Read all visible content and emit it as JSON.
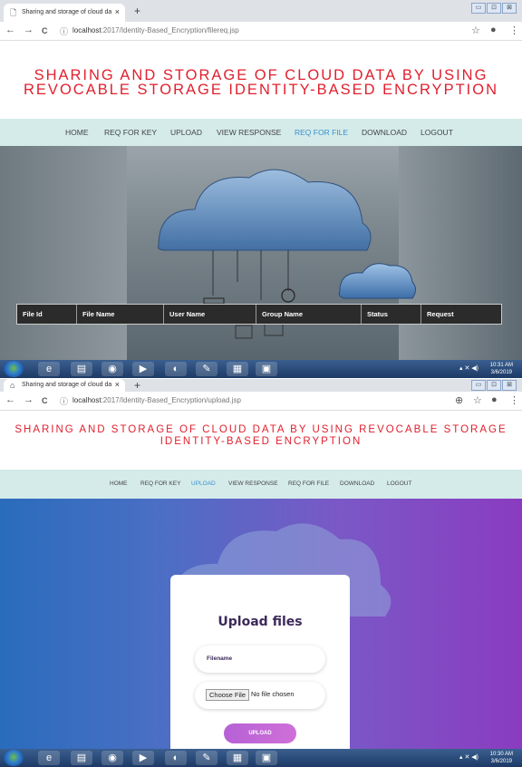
{
  "shot1": {
    "tab": {
      "title": "Sharing and storage of cloud da",
      "close": "×",
      "new_tab": "+"
    },
    "window_buttons": [
      "▭",
      "⊡",
      "⊠"
    ],
    "address": {
      "host": "localhost",
      "path": ":2017/Identity-Based_Encryption/filereq.jsp",
      "info": "ⓘ"
    },
    "nav_icons": {
      "back": "←",
      "forward": "→",
      "reload": "C",
      "star": "☆",
      "account": "●",
      "menu": "⋮"
    },
    "title_line1": "SHARING AND STORAGE OF CLOUD DATA BY USING",
    "title_line2": "REVOCABLE STORAGE IDENTITY-BASED ENCRYPTION",
    "menu": [
      "HOME",
      "REQ FOR KEY",
      "UPLOAD",
      "VIEW RESPONSE",
      "REQ FOR FILE",
      "DOWNLOAD",
      "LOGOUT"
    ],
    "active_menu": "REQ FOR FILE",
    "table_headers": [
      "File Id",
      "File Name",
      "User Name",
      "Group Name",
      "Status",
      "Request"
    ],
    "clock": {
      "time": "10:31 AM",
      "date": "3/6/2019"
    }
  },
  "shot2": {
    "tab": {
      "title": "Sharing and storage of cloud da",
      "close": "×",
      "new_tab": "+"
    },
    "window_buttons": [
      "▭",
      "⊡",
      "⊠"
    ],
    "address": {
      "host": "localhost",
      "path": ":2017/Identity-Based_Encryption/upload.jsp",
      "info": "ⓘ"
    },
    "nav_icons": {
      "back": "←",
      "forward": "→",
      "reload": "C",
      "zoom": "⊕",
      "star": "☆",
      "account": "●",
      "menu": "⋮"
    },
    "title_line1": "SHARING AND STORAGE OF CLOUD DATA BY USING REVOCABLE STORAGE",
    "title_line2": "IDENTITY-BASED ENCRYPTION",
    "menu": [
      "HOME",
      "REQ FOR KEY",
      "UPLOAD",
      "VIEW RESPONSE",
      "REQ FOR FILE",
      "DOWNLOAD",
      "LOGOUT"
    ],
    "active_menu": "UPLOAD",
    "upload": {
      "heading": "Upload files",
      "filename_label": "Filename",
      "choose_file": "Choose File",
      "no_file": "No file chosen",
      "submit": "UPLOAD"
    },
    "clock": {
      "time": "10:30 AM",
      "date": "3/6/2019"
    }
  },
  "taskbar_icons": [
    "internet-explorer-icon",
    "folder-icon",
    "chrome-icon",
    "media-player-icon",
    "eclipse-icon",
    "editor-icon",
    "winrar-icon",
    "remote-icon"
  ],
  "colors": {
    "title_red": "#e0202e",
    "nav_bg": "#d4ebe9",
    "active_link": "#3a8fd0",
    "upload_btn": "#c066d8"
  }
}
